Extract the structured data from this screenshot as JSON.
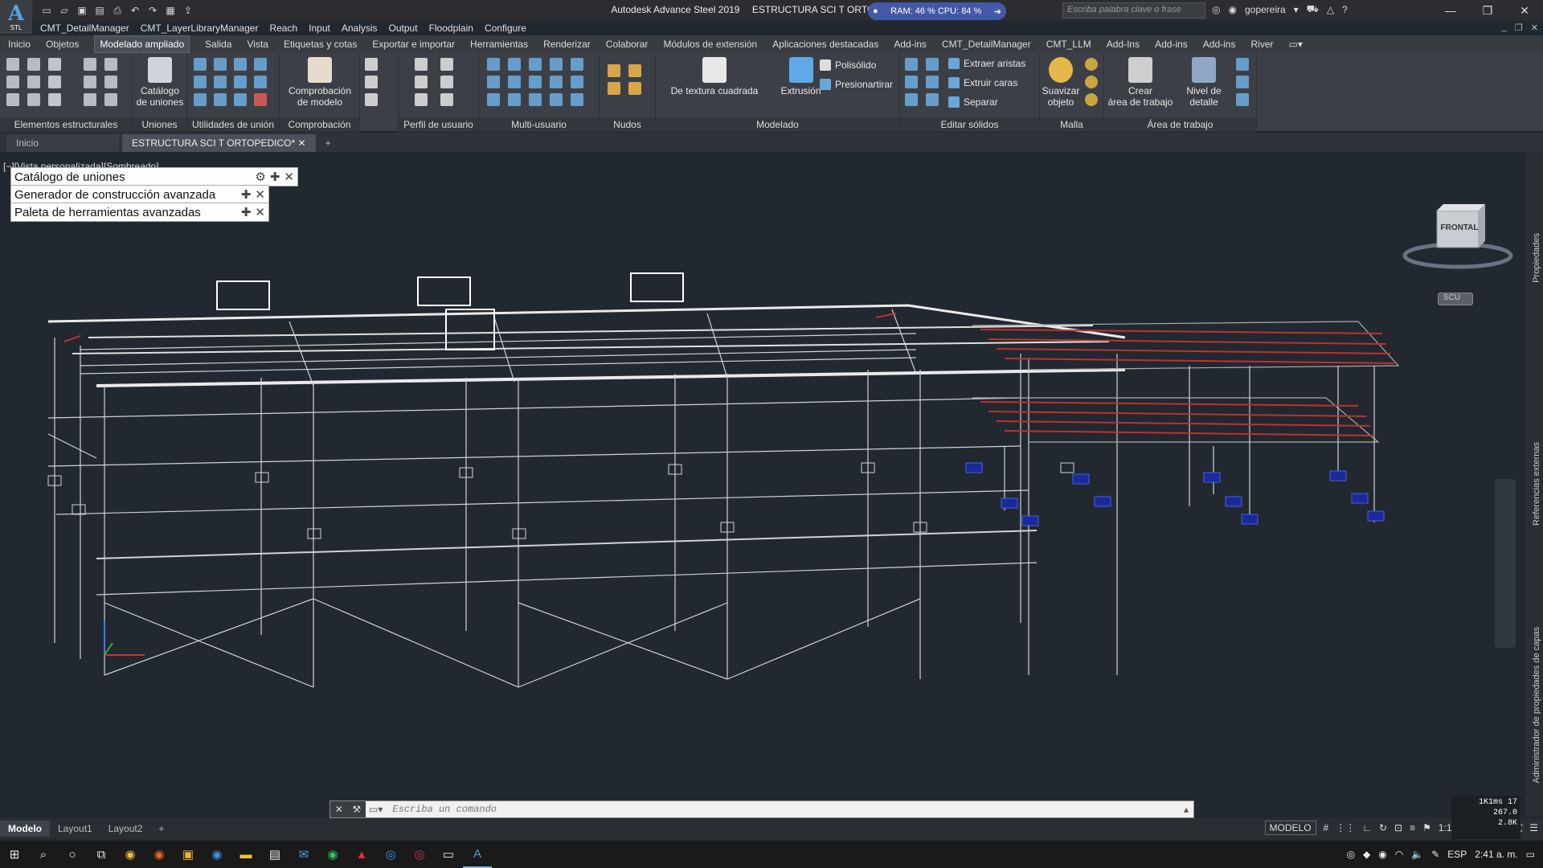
{
  "app": {
    "logo_letter": "A",
    "logo_sub": "STL",
    "name": "Autodesk Advance Steel 2019",
    "document": "ESTRUCTURA SCI T ORTOPEDICO.dwg"
  },
  "resources": {
    "text": "RAM: 46 %  CPU: 84 %"
  },
  "search": {
    "placeholder": "Escriba palabra clave o frase"
  },
  "user": {
    "name": "gopereira"
  },
  "menubar": [
    "CMT_DetailManager",
    "CMT_LayerLibraryManager",
    "Reach",
    "Input",
    "Analysis",
    "Output",
    "Floodplain",
    "Configure"
  ],
  "ribbon_tabs": [
    "Inicio",
    "Objetos",
    "Modelado ampliado",
    "Salida",
    "Vista",
    "Etiquetas y cotas",
    "Exportar e importar",
    "Herramientas",
    "Renderizar",
    "Colaborar",
    "Módulos de extensión",
    "Aplicaciones destacadas",
    "Add-ins",
    "CMT_DetailManager",
    "CMT_LLM",
    "Add-Ins",
    "Add-ins",
    "Add-ins",
    "River"
  ],
  "active_tab_index": 2,
  "panels": {
    "p1": "Elementos estructurales",
    "p2": "Uniones",
    "p3": "Utilidades de unión",
    "p4": "Comprobación",
    "p5": "Perfil de usuario",
    "p6": "Multi-usuario",
    "p7": "Nudos",
    "p8": "Modelado",
    "p9": "Editar sólidos",
    "p10": "Malla",
    "p11": "Área de trabajo"
  },
  "buttons": {
    "catalogo_l1": "Catálogo",
    "catalogo_l2": "de uniones",
    "comprob_l1": "Comprobación",
    "comprob_l2": "de modelo",
    "textura": "De textura cuadrada",
    "extrusion": "Extrusión",
    "polisolido": "Polisólido",
    "presionartirar": "Presionartirar",
    "extraer_aristas": "Extraer aristas",
    "extruir_caras": "Extruir caras",
    "separar": "Separar",
    "suavizar_l1": "Suavizar",
    "suavizar_l2": "objeto",
    "crear_l1": "Crear",
    "crear_l2": "área de trabajo",
    "nivel_l1": "Nivel de",
    "nivel_l2": "detalle"
  },
  "doc_tabs": {
    "start": "Inicio",
    "current": "ESTRUCTURA SCI T ORTOPEDICO*",
    "add": "+"
  },
  "viewport": {
    "label": "[−][Vista personalizada][Sombreado]",
    "viewcube_face": "FRONTAL",
    "ucs": "SCU"
  },
  "palettes": [
    "Catálogo de uniones",
    "Generador de construcción avanzada",
    "Paleta de herramientas avanzadas"
  ],
  "right_panels": [
    "Propiedades",
    "Referencias externas",
    "Administrador de propiedades de capas"
  ],
  "command": {
    "placeholder": "Escriba un comando"
  },
  "layouts": [
    "Modelo",
    "Layout1",
    "Layout2",
    "+"
  ],
  "status": {
    "mode": "MODELO",
    "scale": "1:1"
  },
  "perf": {
    "l1": "1K1ms",
    "l1b": "17",
    "l2": "267.0",
    "l3": "2.8K"
  },
  "tray": {
    "lang": "ESP",
    "time": "2:41 a. m."
  },
  "colors": {
    "accent": "#4458a8",
    "viewport": "#212830",
    "ribbon": "#3c4046"
  }
}
